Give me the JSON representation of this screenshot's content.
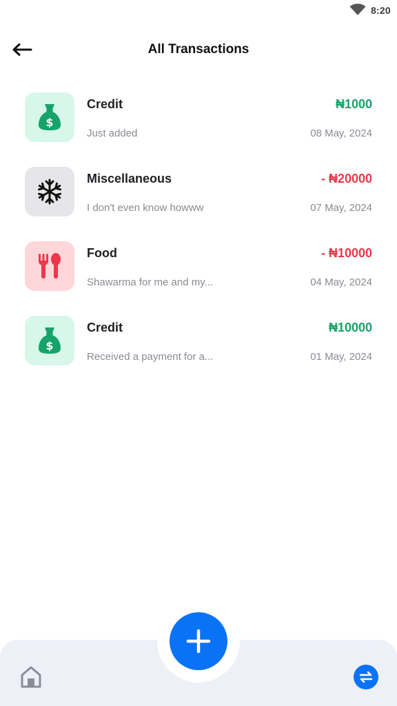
{
  "status_bar": {
    "time": "8:20",
    "icons": [
      "wifi-icon"
    ]
  },
  "header": {
    "title": "All Transactions",
    "back_icon": "arrow-left-icon"
  },
  "colors": {
    "credit_text": "#15a36a",
    "debit_text": "#f0364a",
    "credit_bg": "#d6f7ea",
    "misc_bg": "#e6e6e8",
    "food_bg": "#ffd6d9",
    "accent": "#0a73f5",
    "nav_bg": "#eef0f8"
  },
  "transactions": [
    {
      "category": "Credit",
      "description": "Just added",
      "amount": "₦1000",
      "date": "08 May, 2024",
      "icon": "money-bag-icon",
      "type": "credit"
    },
    {
      "category": "Miscellaneous",
      "description": "I don't even know howww",
      "amount": "- ₦20000",
      "date": "07 May, 2024",
      "icon": "snowflake-icon",
      "type": "debit"
    },
    {
      "category": "Food",
      "description": "Shawarma for me and my...",
      "amount": "- ₦10000",
      "date": "04 May, 2024",
      "icon": "fork-spoon-icon",
      "type": "debit"
    },
    {
      "category": "Credit",
      "description": "Received a payment for a...",
      "amount": "₦10000",
      "date": "01 May, 2024",
      "icon": "money-bag-icon",
      "type": "credit"
    }
  ],
  "bottom_nav": {
    "left_icon": "home-icon",
    "center_icon": "plus-icon",
    "right_icon": "transfer-icon"
  }
}
